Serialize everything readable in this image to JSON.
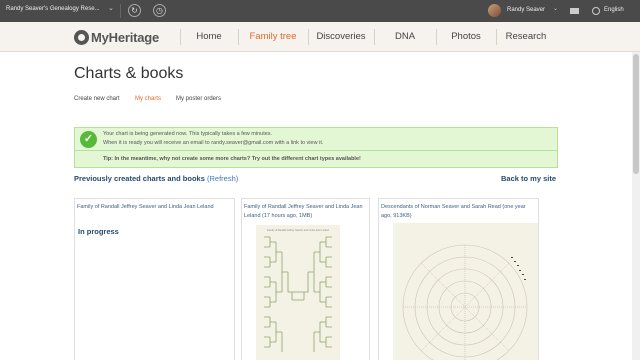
{
  "topbar": {
    "site_name": "Randy Seaver's Genealogy Rese...",
    "user_name": "Randy Seaver",
    "language": "English"
  },
  "nav": {
    "brand": "MyHeritage",
    "items": [
      {
        "label": "Home"
      },
      {
        "label": "Family tree",
        "active": true
      },
      {
        "label": "Discoveries"
      },
      {
        "label": "DNA"
      },
      {
        "label": "Photos"
      },
      {
        "label": "Research"
      }
    ]
  },
  "page": {
    "title": "Charts & books",
    "subnav": [
      {
        "label": "Create new chart"
      },
      {
        "label": "My charts",
        "active": true
      },
      {
        "label": "My poster orders"
      }
    ]
  },
  "notice": {
    "line1": "Your chart is being generated now. This typically takes a few minutes.",
    "line2": "When it is ready you will receive an email to randy.seaver@gmail.com with a link to view it.",
    "tip": "Tip: In the meantime, why not create some more charts? Try out the different chart types available!"
  },
  "section": {
    "heading": "Previously created charts and books",
    "refresh": "(Refresh)",
    "back_link": "Back to my site"
  },
  "cards": [
    {
      "title": "Family of Randall Jeffrey Seaver and Linda Jean Leland",
      "status": "In progress"
    },
    {
      "title": "Family of Randall Jeffrey Seaver and Linda Jean Leland (17 hours ago, 1MB)"
    },
    {
      "title": "Descendants of Norman Seaver and Sarah Read (one year ago, 913KB)"
    }
  ],
  "colors": {
    "accent": "#e06a2e",
    "link": "#244a72",
    "success_bg": "#e3f7d5",
    "success_icon": "#56b93a"
  },
  "icons": {
    "sync": "sync-icon",
    "history": "history-icon",
    "mail": "mail-icon",
    "globe": "globe-icon",
    "check": "check-icon"
  }
}
